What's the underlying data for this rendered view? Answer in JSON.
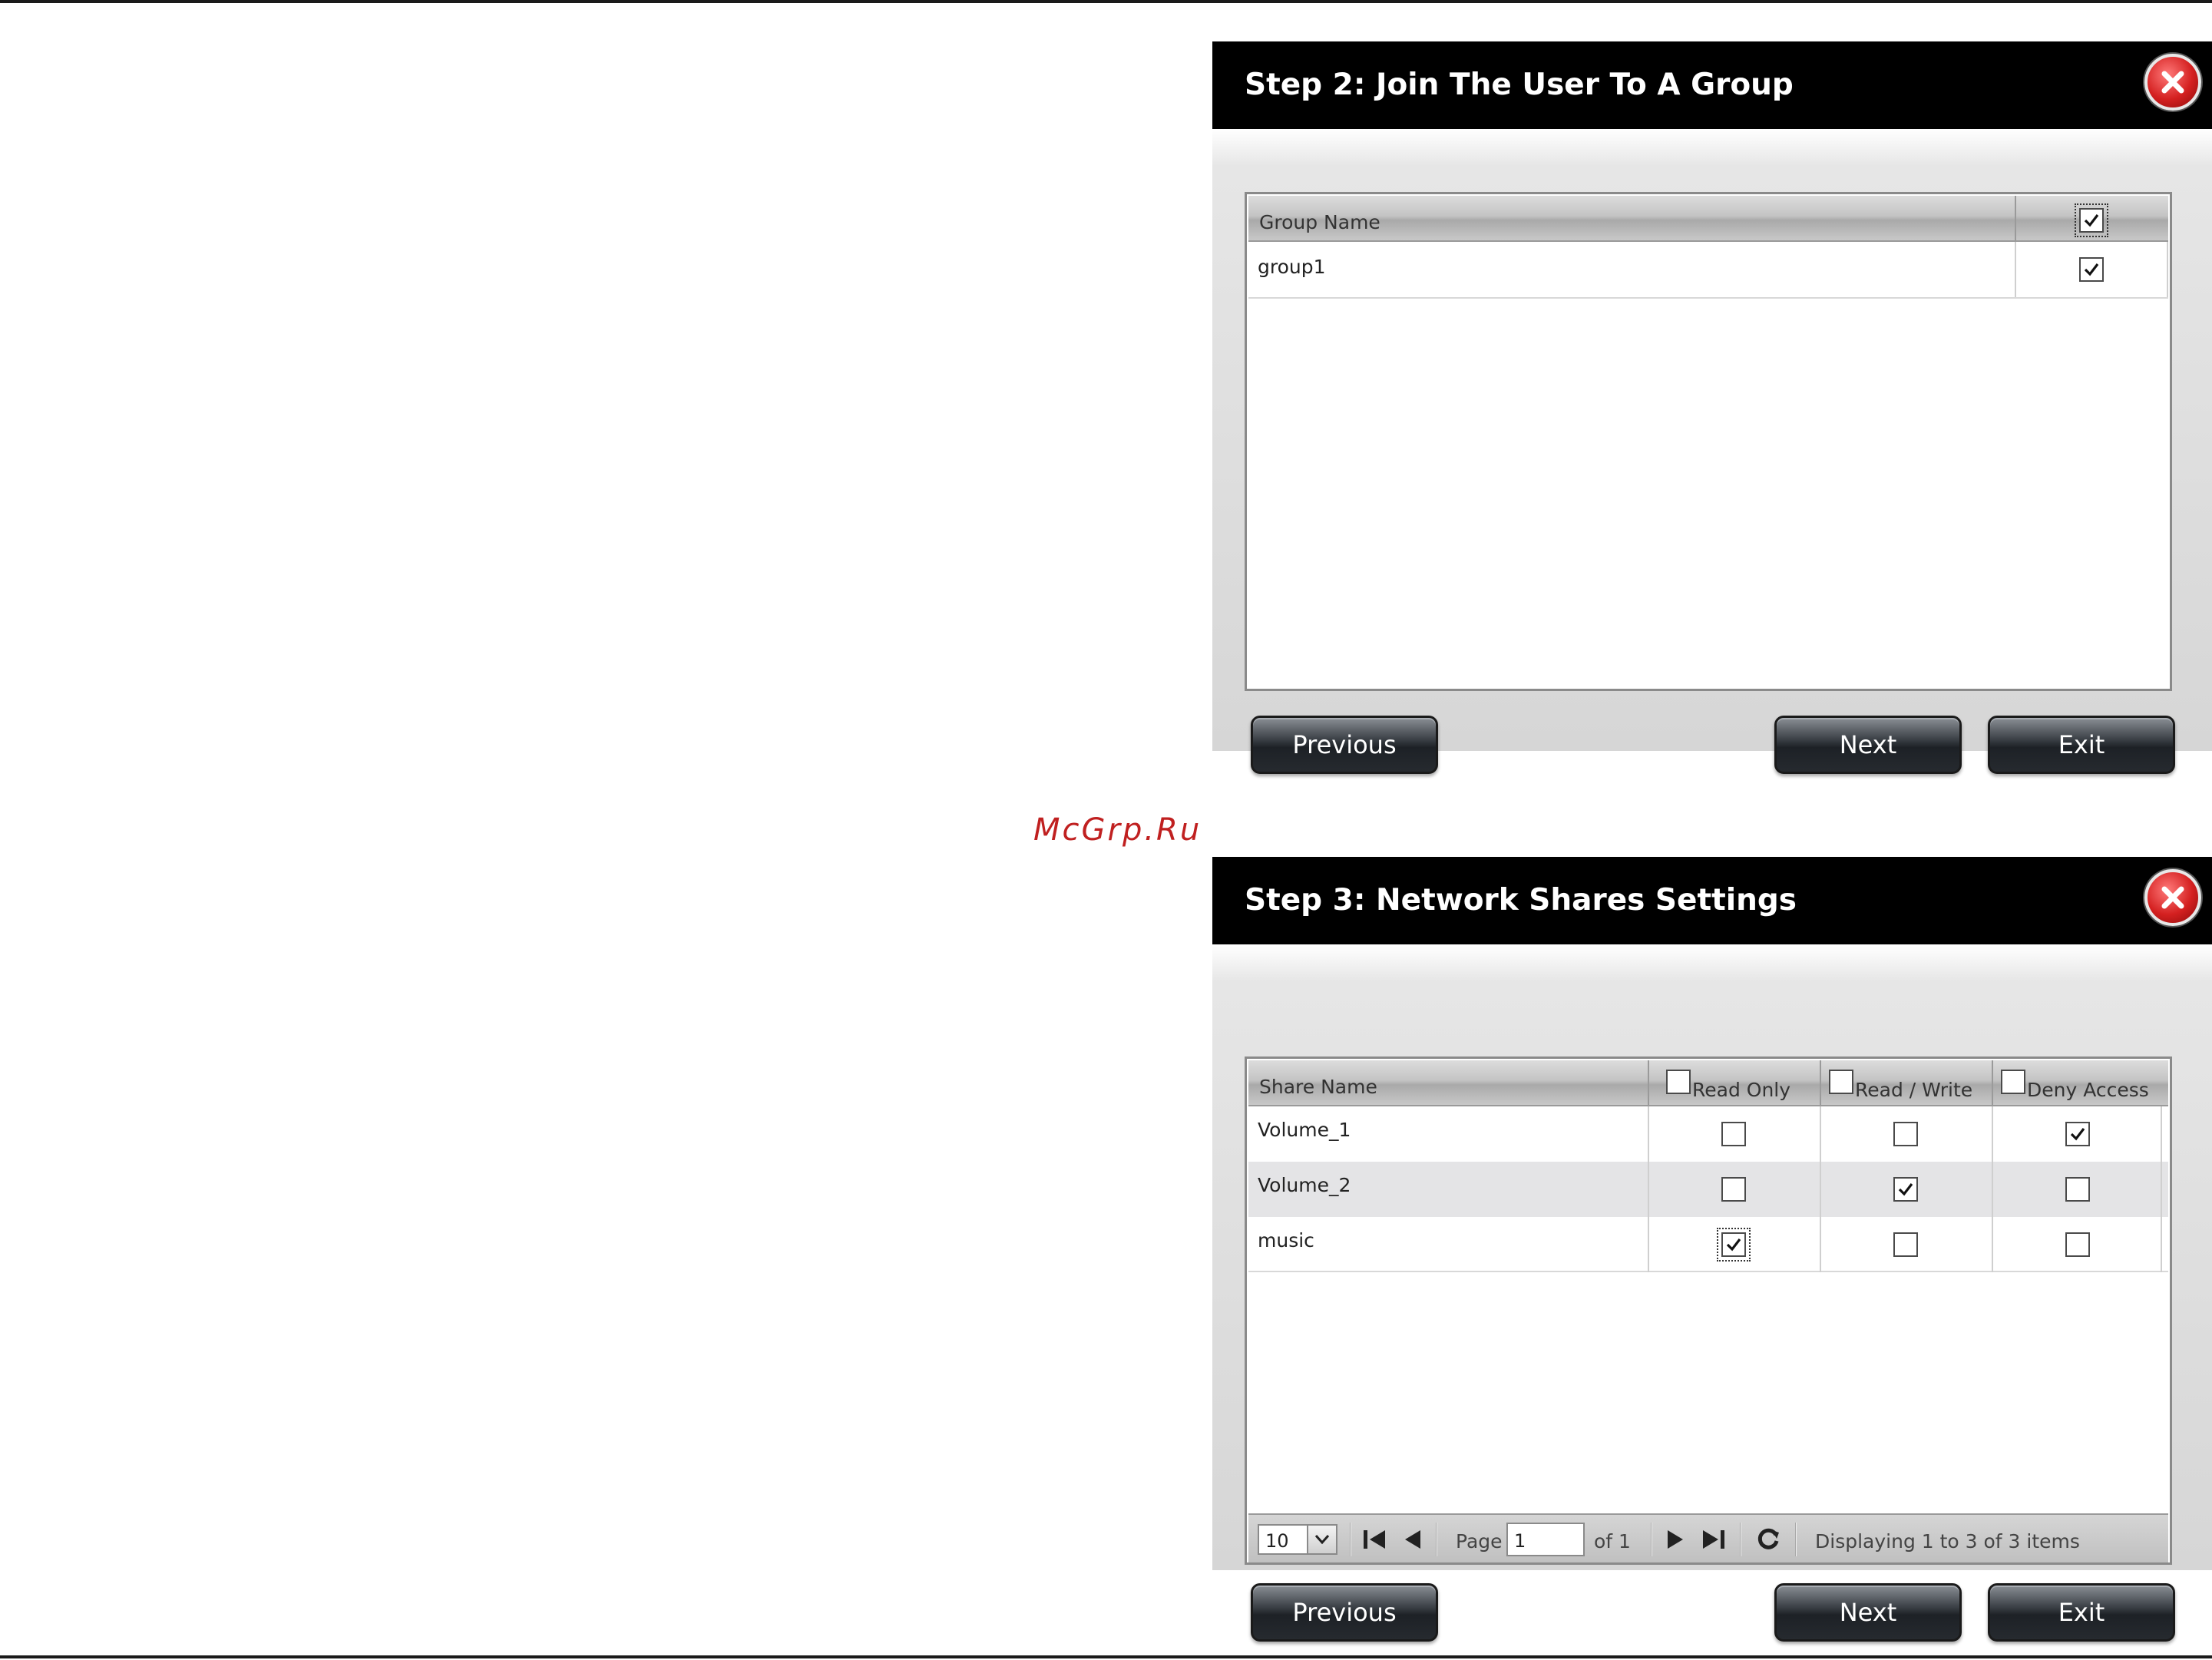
{
  "watermark": "McGrp.Ru",
  "step2": {
    "title": "Step 2: Join The User To A Group",
    "column_header": "Group Name",
    "header_checked": true,
    "rows": [
      {
        "name": "group1",
        "checked": true
      }
    ],
    "buttons": {
      "previous": "Previous",
      "next": "Next",
      "exit": "Exit"
    }
  },
  "step3": {
    "title": "Step 3: Network Shares Settings",
    "columns": {
      "share_name": "Share Name",
      "read_only": "Read Only",
      "read_write": "Read / Write",
      "deny_access": "Deny Access"
    },
    "rows": [
      {
        "name": "Volume_1",
        "read_only": false,
        "read_write": false,
        "deny_access": true
      },
      {
        "name": "Volume_2",
        "read_only": false,
        "read_write": true,
        "deny_access": false
      },
      {
        "name": "music",
        "read_only": true,
        "read_write": false,
        "deny_access": false
      }
    ],
    "pager": {
      "page_size": "10",
      "page_label": "Page",
      "page_value": "1",
      "of_label": "of 1",
      "status": "Displaying 1 to 3 of 3 items"
    },
    "buttons": {
      "previous": "Previous",
      "next": "Next",
      "exit": "Exit"
    }
  }
}
